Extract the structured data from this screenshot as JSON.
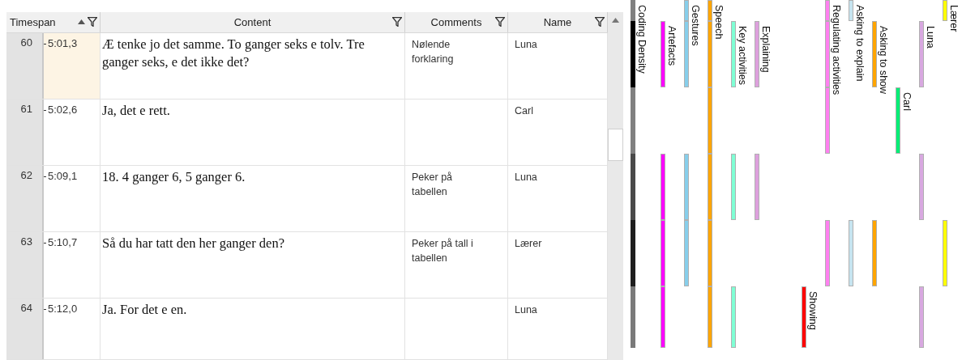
{
  "table": {
    "columns": [
      {
        "label": "Timespan",
        "sorted": true
      },
      {
        "label": "Content",
        "sorted": false
      },
      {
        "label": "Comments",
        "sorted": false
      },
      {
        "label": "Name",
        "sorted": false
      }
    ],
    "rows": [
      {
        "number": "60",
        "timespan": "5:01,3",
        "content": "Æ tenke jo det samme. To ganger seks e tolv. Tre ganger seks, e det ikke det?",
        "comments": "Nølende forklaring",
        "name": "Luna",
        "selected": true
      },
      {
        "number": "61",
        "timespan": "5:02,6",
        "content": "Ja, det e rett.",
        "name": "Carl",
        "selected": false
      },
      {
        "number": "62",
        "timespan": "5:09,1",
        "content": "18. 4 ganger 6, 5 ganger 6.",
        "comments": "Peker på tabellen",
        "name": "Luna",
        "selected": false
      },
      {
        "number": "63",
        "timespan": "5:10,7",
        "content": "Så du har tatt den her ganger den?",
        "comments": "Peker på tall i tabellen",
        "name": "Lærer",
        "selected": false
      },
      {
        "number": "64",
        "timespan": "5:12,0",
        "content": "Ja. For det e en.",
        "name": "Luna",
        "selected": false
      }
    ]
  },
  "coding": {
    "tracks": [
      {
        "label": "Coding Density",
        "kind": "density",
        "segments": [
          {
            "color": "#808080"
          },
          {
            "color": "#000000"
          },
          {
            "color": "#808080"
          },
          {
            "color": "#4a4a4a"
          },
          {
            "color": "#1e1e1e"
          },
          {
            "color": "#7a7a7a"
          }
        ]
      },
      {
        "label": "Artefacts",
        "kind": "code",
        "color": "#ff00ff",
        "active": [
          false,
          true,
          false,
          true,
          true,
          true
        ]
      },
      {
        "label": "Gestures",
        "kind": "code",
        "color": "#87ceeb",
        "active": [
          true,
          true,
          false,
          true,
          true,
          false
        ]
      },
      {
        "label": "Speech",
        "kind": "code",
        "color": "#ffa500",
        "active": [
          true,
          true,
          true,
          true,
          true,
          true
        ]
      },
      {
        "label": "Key activities",
        "kind": "code",
        "color": "#7fffd4",
        "active": [
          false,
          true,
          false,
          true,
          false,
          true
        ]
      },
      {
        "label": "Explaining",
        "kind": "code",
        "color": "#dda0dd",
        "active": [
          false,
          true,
          false,
          true,
          false,
          false
        ]
      },
      {
        "label": "Showing",
        "kind": "code",
        "color": "#ff0000",
        "active": [
          false,
          false,
          false,
          false,
          false,
          true
        ]
      },
      {
        "label": "Regulating activities",
        "kind": "code",
        "color": "#ff80f0",
        "active": [
          true,
          true,
          true,
          false,
          true,
          false
        ]
      },
      {
        "label": "Asking to explain",
        "kind": "code",
        "color": "#c6e4f0",
        "active": [
          true,
          false,
          false,
          false,
          true,
          false
        ]
      },
      {
        "label": "Asking to show",
        "kind": "code",
        "color": "#ffa500",
        "active": [
          false,
          true,
          false,
          false,
          true,
          false
        ]
      },
      {
        "label": "Carl",
        "kind": "code",
        "color": "#00ee76",
        "active": [
          false,
          false,
          true,
          false,
          false,
          false
        ]
      },
      {
        "label": "Luna",
        "kind": "code",
        "color": "#d8a8e0",
        "active": [
          false,
          true,
          false,
          true,
          false,
          true
        ]
      },
      {
        "label": "Lærer",
        "kind": "code",
        "color": "#ffff00",
        "active": [
          true,
          false,
          false,
          false,
          true,
          false
        ]
      }
    ]
  }
}
